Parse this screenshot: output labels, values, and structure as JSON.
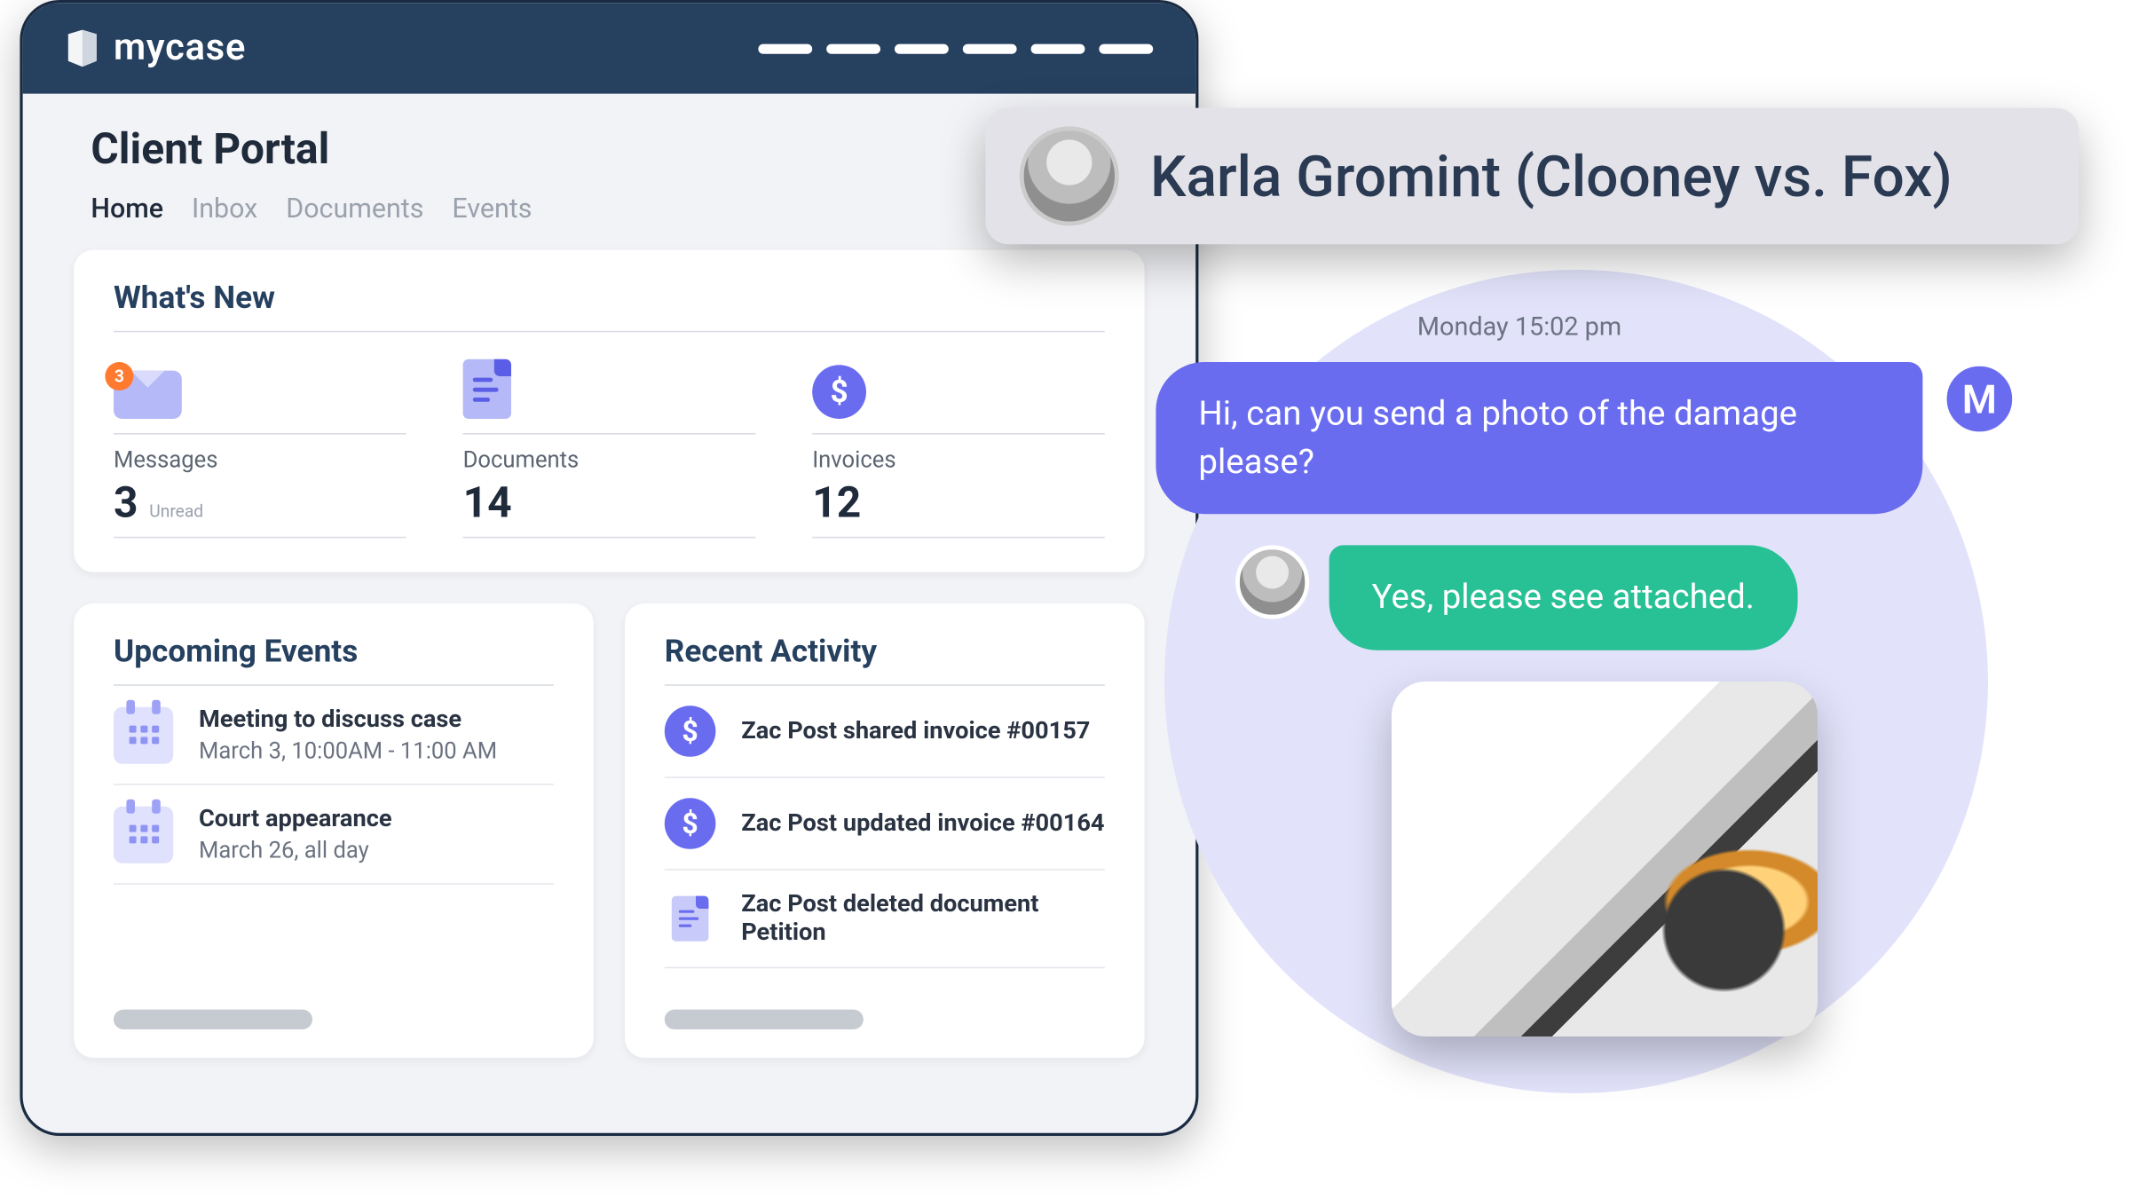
{
  "brand": "mycase",
  "page_title": "Client Portal",
  "tabs": {
    "home": "Home",
    "inbox": "Inbox",
    "documents": "Documents",
    "events": "Events"
  },
  "whats_new": {
    "title": "What's New",
    "messages": {
      "label": "Messages",
      "value": "3",
      "sub": "Unread",
      "badge": "3"
    },
    "documents": {
      "label": "Documents",
      "value": "14"
    },
    "invoices": {
      "label": "Invoices",
      "value": "12"
    }
  },
  "upcoming": {
    "title": "Upcoming Events",
    "items": [
      {
        "title": "Meeting to discuss case",
        "sub": "March 3, 10:00AM - 11:00 AM"
      },
      {
        "title": "Court appearance",
        "sub": "March 26, all day"
      }
    ]
  },
  "activity": {
    "title": "Recent Activity",
    "items": [
      {
        "icon": "dollar",
        "text": "Zac Post shared invoice #00157"
      },
      {
        "icon": "dollar",
        "text": "Zac Post updated invoice #00164"
      },
      {
        "icon": "doc",
        "text": "Zac Post deleted document Petition"
      }
    ]
  },
  "conversation": {
    "contact": "Karla Gromint (Clooney vs. Fox)",
    "timestamp": "Monday 15:02 pm",
    "other_initial": "M",
    "messages": [
      {
        "side": "other",
        "text": "Hi, can you send a photo of the damage please?"
      },
      {
        "side": "self",
        "text": "Yes, please see attached."
      }
    ]
  },
  "colors": {
    "header": "#26405f",
    "accent": "#6a6cf0",
    "success": "#28c095",
    "badge": "#ff7a2f"
  }
}
